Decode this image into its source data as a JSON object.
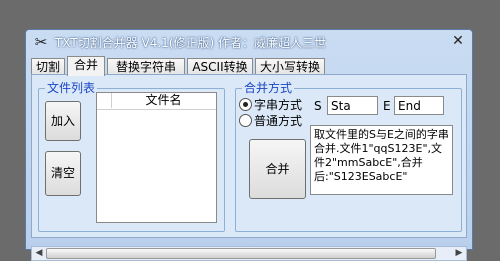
{
  "window": {
    "title": "TXT切割合并器 V4.1(修正版) 作者：威廉超人三世",
    "app_icon": "scissors-icon",
    "close_icon": "close-icon"
  },
  "tabs": [
    {
      "label": "切割",
      "active": false
    },
    {
      "label": "合并",
      "active": true
    },
    {
      "label": "替换字符串",
      "active": false
    },
    {
      "label": "ASCII转换",
      "active": false
    },
    {
      "label": "大小写转换",
      "active": false
    }
  ],
  "file_list": {
    "caption": "文件列表",
    "add_button": "加入",
    "clear_button": "清空",
    "column_header": "文件名"
  },
  "merge_mode": {
    "caption": "合并方式",
    "options": [
      {
        "label": "字串方式",
        "checked": true
      },
      {
        "label": "普通方式",
        "checked": false
      }
    ],
    "start_label": "S",
    "start_value": "Sta",
    "end_label": "E",
    "end_value": "End",
    "merge_button": "合并",
    "description": "取文件里的S与E之间的字串合并.文件1\"qqS123E\",文件2\"mmSabcE\",合并后:\"S123ESabcE\""
  },
  "colors": {
    "accent": "#1b47c4",
    "window_bg": "#c9dcf2",
    "panel_bg": "#dbe8f8"
  }
}
